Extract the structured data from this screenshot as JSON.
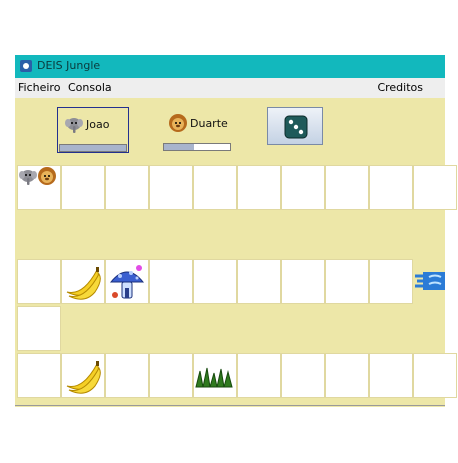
{
  "window": {
    "title": "DEIS Jungle",
    "title_icon": "app-icon"
  },
  "menu": {
    "file": "Ficheiro",
    "console": "Consola",
    "credits": "Creditos"
  },
  "players": [
    {
      "name": "Joao",
      "icon": "elephant-icon",
      "progress": 1.0,
      "active": true
    },
    {
      "name": "Duarte",
      "icon": "lion-icon",
      "progress": 0.45,
      "active": false
    }
  ],
  "dice_button": {
    "icon": "dice-icon"
  },
  "board": {
    "rows": [
      {
        "type": "cells",
        "count": 10,
        "pieces": [
          {
            "col": 0,
            "items": [
              "elephant-icon",
              "lion-icon"
            ]
          }
        ]
      },
      {
        "type": "gap"
      },
      {
        "type": "cells",
        "count": 9,
        "pieces": [
          {
            "col": 1,
            "items": [
              "banana-icon"
            ]
          },
          {
            "col": 2,
            "items": [
              "mushroom-icon"
            ]
          },
          {
            "col": 9,
            "items": [
              "water-icon"
            ]
          }
        ]
      },
      {
        "type": "cells",
        "count": 1,
        "pieces": []
      },
      {
        "type": "cells",
        "count": 10,
        "pieces": [
          {
            "col": 1,
            "items": [
              "banana-icon"
            ]
          },
          {
            "col": 4,
            "items": [
              "grass-icon"
            ]
          }
        ]
      }
    ]
  }
}
